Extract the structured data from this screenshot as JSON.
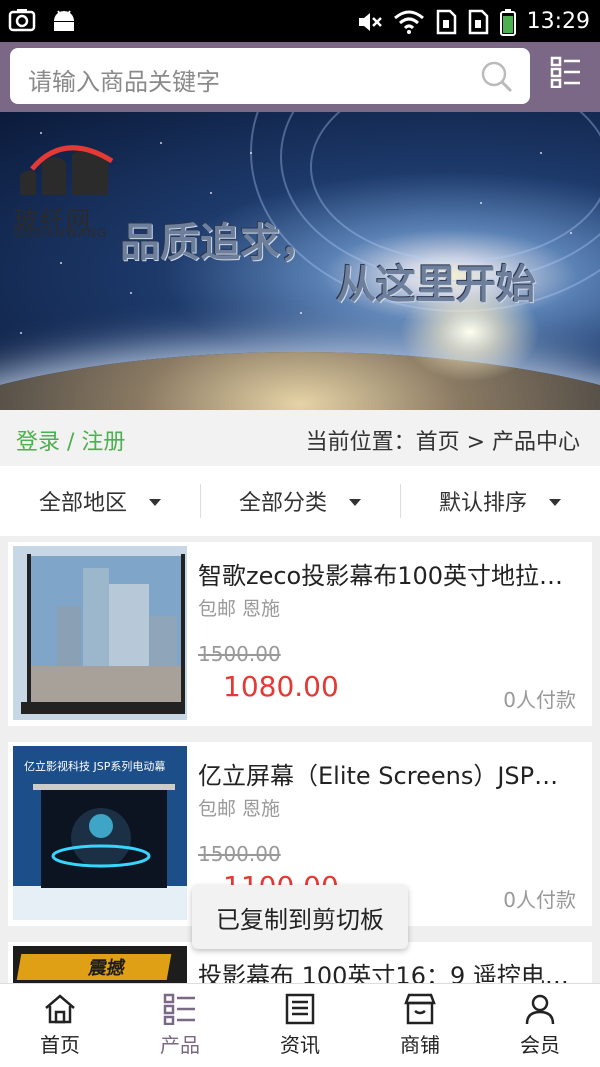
{
  "status_bar": {
    "time": "13:29"
  },
  "search": {
    "placeholder": "请输入商品关键字"
  },
  "banner": {
    "logo_cn": "玻纤网",
    "logo_en": "BOXIANWANG",
    "slogan_line1": "品质追求，",
    "slogan_line2": "从这里开始"
  },
  "info_bar": {
    "login_register": "登录 / 注册",
    "location": "当前位置：首页 > 产品中心"
  },
  "filters": [
    {
      "label": "全部地区"
    },
    {
      "label": "全部分类"
    },
    {
      "label": "默认排序"
    }
  ],
  "products": [
    {
      "title": "智歌zeco投影幕布100英寸地拉…",
      "tags": "包邮 恩施",
      "original_price": "1500.00",
      "price": "1080.00",
      "paid_count": "0人付款"
    },
    {
      "title": "亿立屏幕（Elite Screens）JSP…",
      "tags": "包邮 恩施",
      "original_price": "1500.00",
      "price": "1100.00",
      "paid_count": "0人付款",
      "thumb_caption": "亿立影视科技 JSP系列电动幕"
    },
    {
      "title": "投影幕布 100英寸16：9 遥控电…",
      "thumb_caption": "震撼"
    }
  ],
  "toast": {
    "message": "已复制到剪切板"
  },
  "tab_bar": [
    {
      "label": "首页",
      "icon": "home-icon"
    },
    {
      "label": "产品",
      "icon": "list-icon",
      "active": true
    },
    {
      "label": "资讯",
      "icon": "news-icon"
    },
    {
      "label": "商铺",
      "icon": "shop-icon"
    },
    {
      "label": "会员",
      "icon": "user-icon"
    }
  ],
  "colors": {
    "header": "#7b6786",
    "login": "#4caf50",
    "price": "#e53935"
  }
}
